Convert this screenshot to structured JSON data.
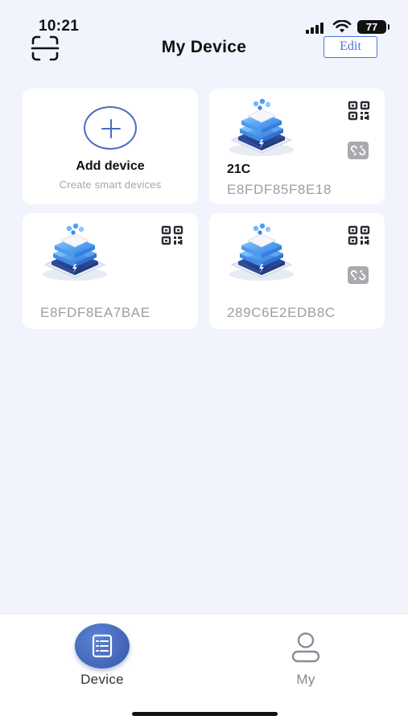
{
  "status_bar": {
    "time": "10:21",
    "battery": "77"
  },
  "header": {
    "title": "My Device",
    "edit_label": "Edit"
  },
  "add_card": {
    "title": "Add device",
    "subtitle": "Create smart devices"
  },
  "devices": [
    {
      "name": "21C",
      "id": "E8FDF85F8E18",
      "has_link_icon": true
    },
    {
      "name": "",
      "id": "E8FDF8EA7BAE",
      "has_link_icon": false
    },
    {
      "name": "",
      "id": "289C6E2EDB8C",
      "has_link_icon": true
    }
  ],
  "tabs": [
    {
      "label": "Device",
      "active": true
    },
    {
      "label": "My",
      "active": false
    }
  ],
  "colors": {
    "accent": "#4a72d6",
    "background": "#f1f4fc",
    "tab_active": "#3857a9"
  }
}
